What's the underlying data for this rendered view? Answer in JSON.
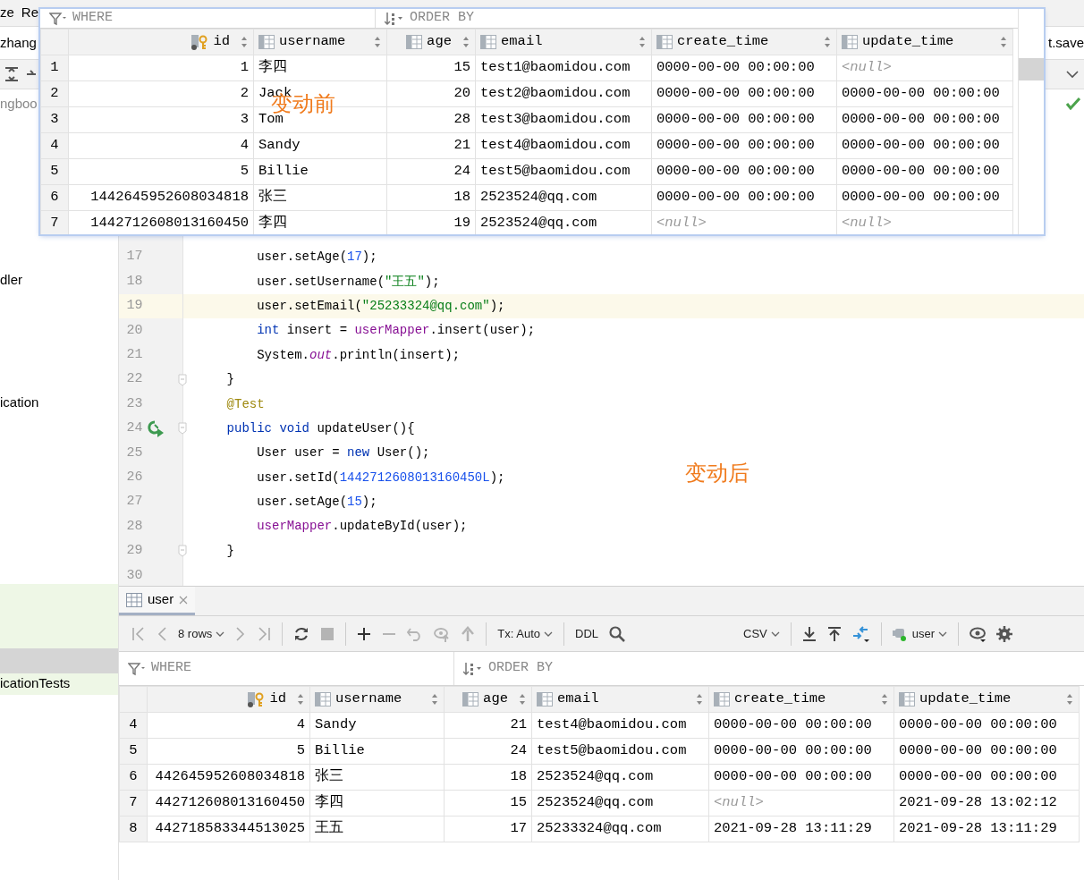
{
  "menu_bar": {
    "items": [
      {
        "text": "ze"
      },
      {
        "text": "Re"
      }
    ]
  },
  "project_bar": {
    "left_label": "zhang",
    "right_label": "t.save"
  },
  "sidebar": {
    "top_item": "ngboo",
    "items": [
      {
        "text": "dler",
        "changed": false
      },
      {
        "text": "ication",
        "changed": false
      },
      {
        "text": "icationTests",
        "changed": true
      }
    ]
  },
  "editor": {
    "lines": [
      {
        "number": "17",
        "highlighted": false,
        "run": false,
        "fold": false,
        "tokens": [
          {
            "kind": "plain",
            "text": "        user.setAge("
          },
          {
            "kind": "number",
            "text": "17"
          },
          {
            "kind": "plain",
            "text": ");"
          }
        ]
      },
      {
        "number": "18",
        "highlighted": false,
        "run": false,
        "fold": false,
        "tokens": [
          {
            "kind": "plain",
            "text": "        user.setUsername("
          },
          {
            "kind": "string",
            "text": "\"王五\""
          },
          {
            "kind": "plain",
            "text": ");"
          }
        ]
      },
      {
        "number": "19",
        "highlighted": true,
        "run": false,
        "fold": false,
        "tokens": [
          {
            "kind": "plain",
            "text": "        user.setEmail("
          },
          {
            "kind": "string",
            "text": "\"25233324@qq.com\""
          },
          {
            "kind": "plain",
            "text": ");"
          }
        ]
      },
      {
        "number": "20",
        "highlighted": false,
        "run": false,
        "fold": false,
        "tokens": [
          {
            "kind": "keyword",
            "text": "        int"
          },
          {
            "kind": "plain",
            "text": " insert = "
          },
          {
            "kind": "field",
            "text": "userMapper"
          },
          {
            "kind": "plain",
            "text": ".insert(user);"
          }
        ]
      },
      {
        "number": "21",
        "highlighted": false,
        "run": false,
        "fold": false,
        "tokens": [
          {
            "kind": "plain",
            "text": "        System."
          },
          {
            "kind": "static",
            "text": "out"
          },
          {
            "kind": "plain",
            "text": ".println(insert);"
          }
        ]
      },
      {
        "number": "22",
        "highlighted": false,
        "run": false,
        "fold": true,
        "tokens": [
          {
            "kind": "plain",
            "text": "    }"
          }
        ]
      },
      {
        "number": "23",
        "highlighted": false,
        "run": false,
        "fold": false,
        "tokens": [
          {
            "kind": "annotation",
            "text": "    @Test"
          }
        ]
      },
      {
        "number": "24",
        "highlighted": false,
        "run": true,
        "fold": true,
        "tokens": [
          {
            "kind": "keyword",
            "text": "    public void"
          },
          {
            "kind": "plain",
            "text": " updateUser(){"
          }
        ]
      },
      {
        "number": "25",
        "highlighted": false,
        "run": false,
        "fold": false,
        "tokens": [
          {
            "kind": "plain",
            "text": "        User user = "
          },
          {
            "kind": "keyword",
            "text": "new"
          },
          {
            "kind": "plain",
            "text": " User();"
          }
        ]
      },
      {
        "number": "26",
        "highlighted": false,
        "run": false,
        "fold": false,
        "tokens": [
          {
            "kind": "plain",
            "text": "        user.setId("
          },
          {
            "kind": "number",
            "text": "1442712608013160450L"
          },
          {
            "kind": "plain",
            "text": ");"
          }
        ]
      },
      {
        "number": "27",
        "highlighted": false,
        "run": false,
        "fold": false,
        "tokens": [
          {
            "kind": "plain",
            "text": "        user.setAge("
          },
          {
            "kind": "number",
            "text": "15"
          },
          {
            "kind": "plain",
            "text": ");"
          }
        ]
      },
      {
        "number": "28",
        "highlighted": false,
        "run": false,
        "fold": false,
        "tokens": [
          {
            "kind": "field",
            "text": "        userMapper"
          },
          {
            "kind": "plain",
            "text": ".updateById(user);"
          }
        ]
      },
      {
        "number": "29",
        "highlighted": false,
        "run": false,
        "fold": true,
        "tokens": [
          {
            "kind": "plain",
            "text": "    }"
          }
        ]
      },
      {
        "number": "30",
        "highlighted": false,
        "run": false,
        "fold": false
      }
    ]
  },
  "popup_table": {
    "where_label": "WHERE",
    "order_label": "ORDER BY",
    "columns": [
      {
        "name": "id",
        "key": true,
        "numeric": true
      },
      {
        "name": "username",
        "key": false,
        "numeric": false
      },
      {
        "name": "age",
        "key": false,
        "numeric": true
      },
      {
        "name": "email",
        "key": false,
        "numeric": false
      },
      {
        "name": "create_time",
        "key": false,
        "numeric": false
      },
      {
        "name": "update_time",
        "key": false,
        "numeric": false
      }
    ],
    "rows": [
      {
        "row_number": "1",
        "cells": [
          {
            "text": "1",
            "is_null": false
          },
          {
            "text": "李四",
            "is_null": false
          },
          {
            "text": "15",
            "is_null": false
          },
          {
            "text": "test1@baomidou.com",
            "is_null": false
          },
          {
            "text": "0000-00-00 00:00:00",
            "is_null": false
          },
          {
            "text": "<null>",
            "is_null": true
          }
        ]
      },
      {
        "row_number": "2",
        "cells": [
          {
            "text": "2",
            "is_null": false
          },
          {
            "text": "Jack",
            "is_null": false
          },
          {
            "text": "20",
            "is_null": false
          },
          {
            "text": "test2@baomidou.com",
            "is_null": false
          },
          {
            "text": "0000-00-00 00:00:00",
            "is_null": false
          },
          {
            "text": "0000-00-00 00:00:00",
            "is_null": false
          }
        ]
      },
      {
        "row_number": "3",
        "cells": [
          {
            "text": "3",
            "is_null": false
          },
          {
            "text": "Tom",
            "is_null": false
          },
          {
            "text": "28",
            "is_null": false
          },
          {
            "text": "test3@baomidou.com",
            "is_null": false
          },
          {
            "text": "0000-00-00 00:00:00",
            "is_null": false
          },
          {
            "text": "0000-00-00 00:00:00",
            "is_null": false
          }
        ]
      },
      {
        "row_number": "4",
        "cells": [
          {
            "text": "4",
            "is_null": false
          },
          {
            "text": "Sandy",
            "is_null": false
          },
          {
            "text": "21",
            "is_null": false
          },
          {
            "text": "test4@baomidou.com",
            "is_null": false
          },
          {
            "text": "0000-00-00 00:00:00",
            "is_null": false
          },
          {
            "text": "0000-00-00 00:00:00",
            "is_null": false
          }
        ]
      },
      {
        "row_number": "5",
        "cells": [
          {
            "text": "5",
            "is_null": false
          },
          {
            "text": "Billie",
            "is_null": false
          },
          {
            "text": "24",
            "is_null": false
          },
          {
            "text": "test5@baomidou.com",
            "is_null": false
          },
          {
            "text": "0000-00-00 00:00:00",
            "is_null": false
          },
          {
            "text": "0000-00-00 00:00:00",
            "is_null": false
          }
        ]
      },
      {
        "row_number": "6",
        "cells": [
          {
            "text": "1442645952608034818",
            "is_null": false
          },
          {
            "text": "张三",
            "is_null": false
          },
          {
            "text": "18",
            "is_null": false
          },
          {
            "text": "2523524@qq.com",
            "is_null": false
          },
          {
            "text": "0000-00-00 00:00:00",
            "is_null": false
          },
          {
            "text": "0000-00-00 00:00:00",
            "is_null": false
          }
        ]
      },
      {
        "row_number": "7",
        "cells": [
          {
            "text": "1442712608013160450",
            "is_null": false
          },
          {
            "text": "李四",
            "is_null": false
          },
          {
            "text": "19",
            "is_null": false
          },
          {
            "text": "2523524@qq.com",
            "is_null": false
          },
          {
            "text": "<null>",
            "is_null": true
          },
          {
            "text": "<null>",
            "is_null": true
          }
        ]
      }
    ]
  },
  "results_panel": {
    "tab": {
      "label": "user",
      "selected": true
    },
    "toolbar": {
      "rows_label": "8 rows",
      "tx_label": "Tx: Auto",
      "ddl_label": "DDL",
      "format_label": "CSV",
      "schema_label": "user",
      "navigation_disabled": true,
      "edit_disabled": true
    },
    "where_label": "WHERE",
    "order_label": "ORDER BY",
    "columns": [
      {
        "name": "id",
        "key": true,
        "numeric": true
      },
      {
        "name": "username",
        "key": false,
        "numeric": false
      },
      {
        "name": "age",
        "key": false,
        "numeric": true
      },
      {
        "name": "email",
        "key": false,
        "numeric": false
      },
      {
        "name": "create_time",
        "key": false,
        "numeric": false
      },
      {
        "name": "update_time",
        "key": false,
        "numeric": false
      }
    ],
    "rows": [
      {
        "row_number": "4",
        "cells": [
          {
            "text": "4",
            "is_null": false
          },
          {
            "text": "Sandy",
            "is_null": false
          },
          {
            "text": "21",
            "is_null": false
          },
          {
            "text": "test4@baomidou.com",
            "is_null": false
          },
          {
            "text": "0000-00-00 00:00:00",
            "is_null": false
          },
          {
            "text": "0000-00-00 00:00:00",
            "is_null": false
          }
        ]
      },
      {
        "row_number": "5",
        "cells": [
          {
            "text": "5",
            "is_null": false
          },
          {
            "text": "Billie",
            "is_null": false
          },
          {
            "text": "24",
            "is_null": false
          },
          {
            "text": "test5@baomidou.com",
            "is_null": false
          },
          {
            "text": "0000-00-00 00:00:00",
            "is_null": false
          },
          {
            "text": "0000-00-00 00:00:00",
            "is_null": false
          }
        ]
      },
      {
        "row_number": "6",
        "cells": [
          {
            "text": "442645952608034818",
            "is_null": false
          },
          {
            "text": "张三",
            "is_null": false
          },
          {
            "text": "18",
            "is_null": false
          },
          {
            "text": "2523524@qq.com",
            "is_null": false
          },
          {
            "text": "0000-00-00 00:00:00",
            "is_null": false
          },
          {
            "text": "0000-00-00 00:00:00",
            "is_null": false
          }
        ]
      },
      {
        "row_number": "7",
        "cells": [
          {
            "text": "442712608013160450",
            "is_null": false
          },
          {
            "text": "李四",
            "is_null": false
          },
          {
            "text": "15",
            "is_null": false
          },
          {
            "text": "2523524@qq.com",
            "is_null": false
          },
          {
            "text": "<null>",
            "is_null": true
          },
          {
            "text": "2021-09-28 13:02:12",
            "is_null": false
          }
        ]
      },
      {
        "row_number": "8",
        "cells": [
          {
            "text": "442718583344513025",
            "is_null": false
          },
          {
            "text": "王五",
            "is_null": false
          },
          {
            "text": "17",
            "is_null": false
          },
          {
            "text": "25233324@qq.com",
            "is_null": false
          },
          {
            "text": "2021-09-28 13:11:29",
            "is_null": false
          },
          {
            "text": "2021-09-28 13:11:29",
            "is_null": false
          }
        ]
      }
    ]
  },
  "annotations": [
    {
      "text": "变动前"
    },
    {
      "text": "变动后"
    }
  ]
}
